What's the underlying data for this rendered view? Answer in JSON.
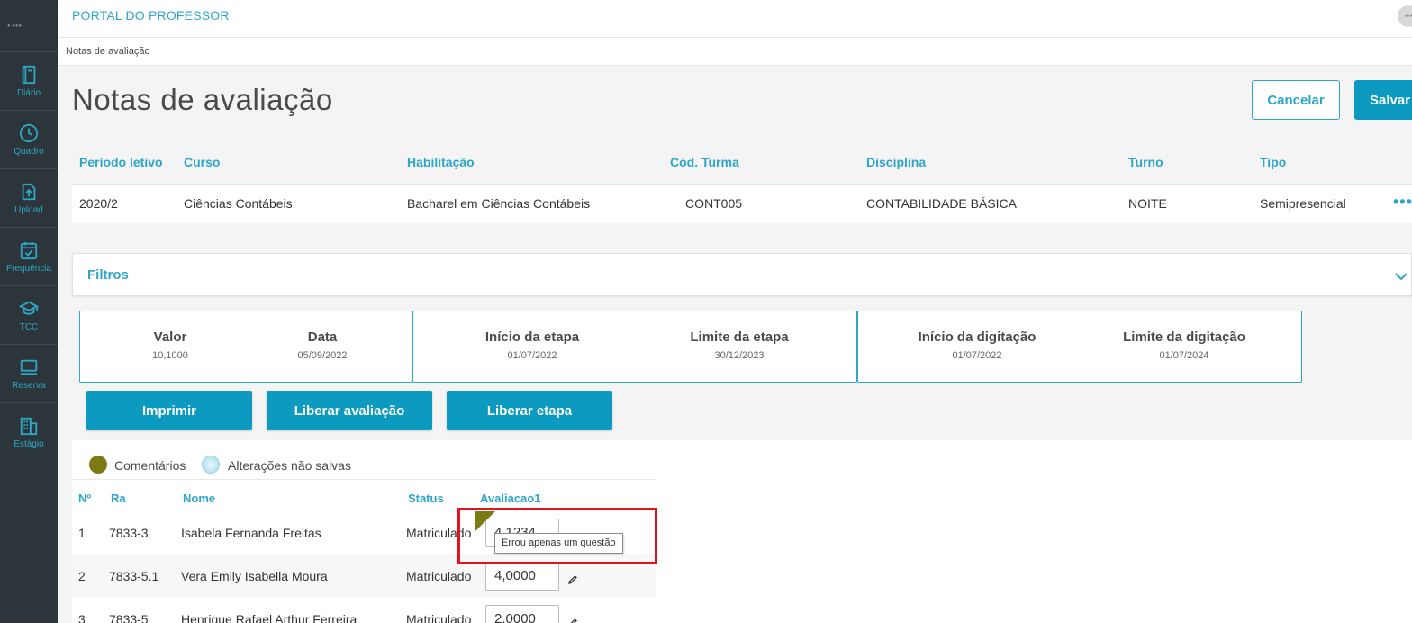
{
  "sidebar": {
    "logo": "● ●●●",
    "items": [
      {
        "label": "Diário",
        "icon": "book-icon"
      },
      {
        "label": "Quadro",
        "icon": "clock-icon"
      },
      {
        "label": "Upload",
        "icon": "upload-icon"
      },
      {
        "label": "Frequência",
        "icon": "calendar-check-icon"
      },
      {
        "label": "TCC",
        "icon": "graduation-cap-icon"
      },
      {
        "label": "Reserva",
        "icon": "monitor-icon"
      },
      {
        "label": "Estágio",
        "icon": "building-icon"
      }
    ]
  },
  "header": {
    "title": "PORTAL DO PROFESSOR",
    "avatar": "●●●"
  },
  "breadcrumb": "Notas de avaliação",
  "page": {
    "title": "Notas de avaliação",
    "cancel_label": "Cancelar",
    "save_label": "Salvar"
  },
  "info": {
    "headers": [
      "Período letivo",
      "Curso",
      "Habilitação",
      "Cód. Turma",
      "Disciplina",
      "Turno",
      "Tipo"
    ],
    "values": [
      "2020/2",
      "Ciências Contábeis",
      "Bacharel em Ciências Contábeis",
      "CONT005",
      "CONTABILIDADE BÁSICA",
      "NOITE",
      "Semipresencial"
    ],
    "more": "•••"
  },
  "filters": {
    "title": "Filtros"
  },
  "cards": [
    {
      "blocks": [
        {
          "label": "Valor",
          "value": "10,1000"
        },
        {
          "label": "Data",
          "value": "05/09/2022"
        }
      ]
    },
    {
      "blocks": [
        {
          "label": "Início da etapa",
          "value": "01/07/2022"
        },
        {
          "label": "Limite da etapa",
          "value": "30/12/2023"
        }
      ]
    },
    {
      "blocks": [
        {
          "label": "Início da digitação",
          "value": "01/07/2022"
        },
        {
          "label": "Limite da digitação",
          "value": "01/07/2024"
        }
      ]
    }
  ],
  "actions": {
    "print": "Imprimir",
    "release_eval": "Liberar avaliação",
    "release_stage": "Liberar etapa"
  },
  "legend": {
    "comments": "Comentários",
    "unsaved": "Alterações não salvas",
    "comments_color": "#7c7a12",
    "unsaved_color": "#bfe6f2"
  },
  "grid": {
    "headers": [
      "Nº",
      "Ra",
      "Nome",
      "Status",
      "Avaliacao1"
    ],
    "rows": [
      {
        "n": "1",
        "ra": "7833-3",
        "nome": "Isabela Fernanda Freitas",
        "status": "Matriculado",
        "nota": "4,1234"
      },
      {
        "n": "2",
        "ra": "7833-5.1",
        "nome": "Vera Emily Isabella Moura",
        "status": "Matriculado",
        "nota": "4,0000"
      },
      {
        "n": "3",
        "ra": "7833-5",
        "nome": "Henrique Rafael Arthur Ferreira",
        "status": "Matriculado",
        "nota": "2,0000"
      }
    ]
  },
  "tooltip": "Errou apenas um questão"
}
